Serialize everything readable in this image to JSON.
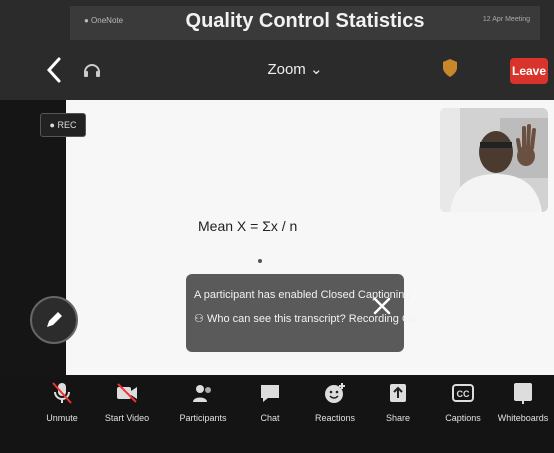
{
  "slide": {
    "title": "Quality Control Statistics",
    "mini_left": "● OneNote",
    "mini_right": "12 Apr Meeting"
  },
  "header": {
    "zoom_label": "Zoom ⌄",
    "leave_label": "Leave"
  },
  "rec_badge": "● REC",
  "content": {
    "formula": "Mean X = Σx / n"
  },
  "caption_popup": {
    "line1": "A participant has enabled Closed Captioning",
    "line2": "Who can see this transcript? Recording On"
  },
  "toolbar": [
    {
      "label": "Unmute",
      "icon": "mic-off-icon"
    },
    {
      "label": "Start Video",
      "icon": "video-off-icon"
    },
    {
      "label": "Participants",
      "icon": "participants-icon"
    },
    {
      "label": "Chat",
      "icon": "chat-icon"
    },
    {
      "label": "Reactions",
      "icon": "reactions-icon"
    },
    {
      "label": "Share",
      "icon": "share-icon"
    },
    {
      "label": "Captions",
      "icon": "captions-icon"
    },
    {
      "label": "Whiteboards",
      "icon": "whiteboard-icon"
    }
  ],
  "colors": {
    "leave": "#d9342b",
    "toolbar_bg": "#141414",
    "content_bg": "#f7f7f7"
  }
}
